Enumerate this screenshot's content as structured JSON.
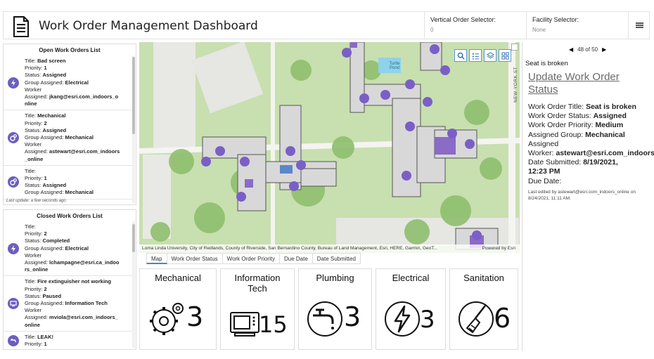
{
  "header": {
    "title": "Work Order Management Dashboard",
    "vertical_selector": {
      "label": "Vertical Order Selector:",
      "value": "0"
    },
    "facility_selector": {
      "label": "Facility Selector:",
      "value": "None"
    }
  },
  "open_list": {
    "title": "Open Work Orders List",
    "last_update": "Last update: a few seconds ago",
    "items": [
      {
        "icon": "lightning-icon",
        "lines": [
          {
            "k": "Title: ",
            "v": "Bad screen"
          },
          {
            "k": "Priority: ",
            "v": "1"
          },
          {
            "k": "Status: ",
            "v": "Assigned"
          },
          {
            "k": "Group Assigned: ",
            "v": "Electrical"
          },
          {
            "k": "",
            "v": "",
            "plain": "Worker"
          },
          {
            "k": "Assigned: ",
            "v": "jkang@esri.com_indoors_o"
          },
          {
            "k": "",
            "v": "",
            "bold_plain": "nline"
          }
        ]
      },
      {
        "icon": "gears-icon",
        "lines": [
          {
            "k": "Title: ",
            "v": "Mechanical"
          },
          {
            "k": "Priority: ",
            "v": "2"
          },
          {
            "k": "Status: ",
            "v": "Assigned"
          },
          {
            "k": "Group Assigned: ",
            "v": "Mechanical"
          },
          {
            "k": "",
            "v": "",
            "plain": "Worker"
          },
          {
            "k": "Assigned: ",
            "v": "astewart@esri.com_indoors"
          },
          {
            "k": "",
            "v": "",
            "bold_plain": "_online"
          }
        ]
      },
      {
        "icon": "gears-icon",
        "lines": [
          {
            "k": "Title:",
            "v": ""
          },
          {
            "k": "Priority: ",
            "v": "1"
          },
          {
            "k": "Status: ",
            "v": "Assigned"
          },
          {
            "k": "Group Assigned: ",
            "v": "Mechanical"
          }
        ]
      }
    ]
  },
  "closed_list": {
    "title": "Closed Work Orders List",
    "items": [
      {
        "icon": "lightning-icon",
        "lines": [
          {
            "k": "Title:",
            "v": ""
          },
          {
            "k": "Priority: ",
            "v": "2"
          },
          {
            "k": "Status: ",
            "v": "Completed"
          },
          {
            "k": "Group Assigned: ",
            "v": "Electrical"
          },
          {
            "k": "",
            "v": "",
            "plain": "Worker"
          },
          {
            "k": "Assigned: ",
            "v": "lchampagne@esri.ca_indoo"
          },
          {
            "k": "",
            "v": "",
            "bold_plain": "rs_online"
          }
        ]
      },
      {
        "icon": "monitor-icon",
        "lines": [
          {
            "k": "Title: ",
            "v": "Fire extinguisher not working"
          },
          {
            "k": "Priority: ",
            "v": "2"
          },
          {
            "k": "Status: ",
            "v": "Paused"
          },
          {
            "k": "Group Assigned: ",
            "v": "Information Tech"
          },
          {
            "k": "",
            "v": "",
            "plain": "Worker"
          },
          {
            "k": "Assigned: ",
            "v": "mviola@esri.com_indoors_"
          },
          {
            "k": "",
            "v": "",
            "bold_plain": "online"
          }
        ]
      },
      {
        "icon": "faucet-icon",
        "lines": [
          {
            "k": "Title: ",
            "v": "LEAK!"
          },
          {
            "k": "Priority: ",
            "v": "1"
          }
        ]
      }
    ]
  },
  "map": {
    "attribution": "Loma Linda University, City of Redlands, County of Riverside, San Bernardino County, Bureau of Land Management, Esri, HERE, Garmin, GeoT...",
    "powered_by": "Powered by Esri",
    "street_label": "NEW YORK ST",
    "pond_label": "Turtle Pond"
  },
  "tabs": [
    "Map",
    "Work Order Status",
    "Work Order Priority",
    "Due Date",
    "Date Submitted"
  ],
  "categories": [
    {
      "name": "Mechanical",
      "count": "3",
      "icon": "gears-icon"
    },
    {
      "name": "Information Tech",
      "count": "15",
      "icon": "computer-icon"
    },
    {
      "name": "Plumbing",
      "count": "3",
      "icon": "faucet-icon"
    },
    {
      "name": "Electrical",
      "count": "3",
      "icon": "lightning-icon"
    },
    {
      "name": "Sanitation",
      "count": "6",
      "icon": "broom-icon"
    }
  ],
  "detail": {
    "pager": "48 of 50",
    "header_title": "Seat is broken",
    "update_link": "Update Work Order Status",
    "fields": {
      "title_label": "Work Order Title: ",
      "title_value": "Seat is broken",
      "status_label": "Work Order Status: ",
      "status_value": "Assigned",
      "priority_label": "Work Order Priority: ",
      "priority_value": "Medium",
      "group_label": "Assigned Group: ",
      "group_value": "Mechanical",
      "assigned_line": "Assigned",
      "worker_label": "Worker: ",
      "worker_value": "astewart@esri.com_indoors",
      "date_label": "Date Submitted: ",
      "date_value_1": "8/19/2021,",
      "date_value_2": "12:23 PM",
      "due_label": "Due Date:"
    },
    "edited": "Last edited by astewart@esri.com_indoors_online on 8/24/2021, 11:11 AM."
  },
  "colors": {
    "accent_purple": "#6b5fbf",
    "tab_accent": "#4a84c4",
    "map_green": "#a9cf8a"
  }
}
